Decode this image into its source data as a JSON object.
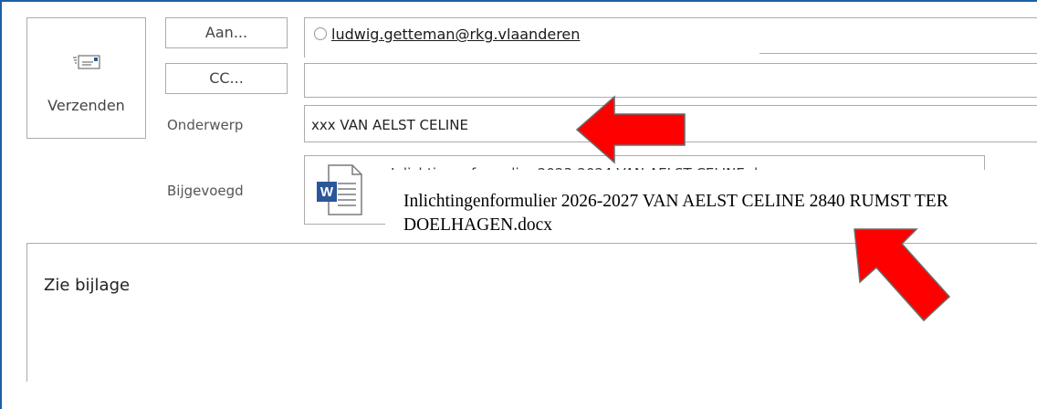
{
  "send": {
    "label": "Verzenden",
    "icon": "send-envelope-icon"
  },
  "fields": {
    "to_button": "Aan...",
    "cc_button": "CC...",
    "subject_label": "Onderwerp",
    "attached_label": "Bijgevoegd"
  },
  "to": {
    "recipient": "ludwig.getteman@rkg.vlaanderen"
  },
  "cc": {
    "value": ""
  },
  "subject": {
    "value": "xxx VAN AELST CELINE"
  },
  "attachment": {
    "icon": "word-document-icon",
    "partial_name": "Inlichtingenformulier 2023-2024 VAN AELST CELINE.docx",
    "overlay_name": "Inlichtingenformulier 2026-2027 VAN AELST CELINE 2840 RUMST TER DOELHAGEN.docx"
  },
  "message": {
    "body": "Zie bijlage"
  },
  "colors": {
    "accent_border": "#1f5fa8",
    "word_blue": "#2b579a",
    "arrow_red": "#ff0000"
  }
}
